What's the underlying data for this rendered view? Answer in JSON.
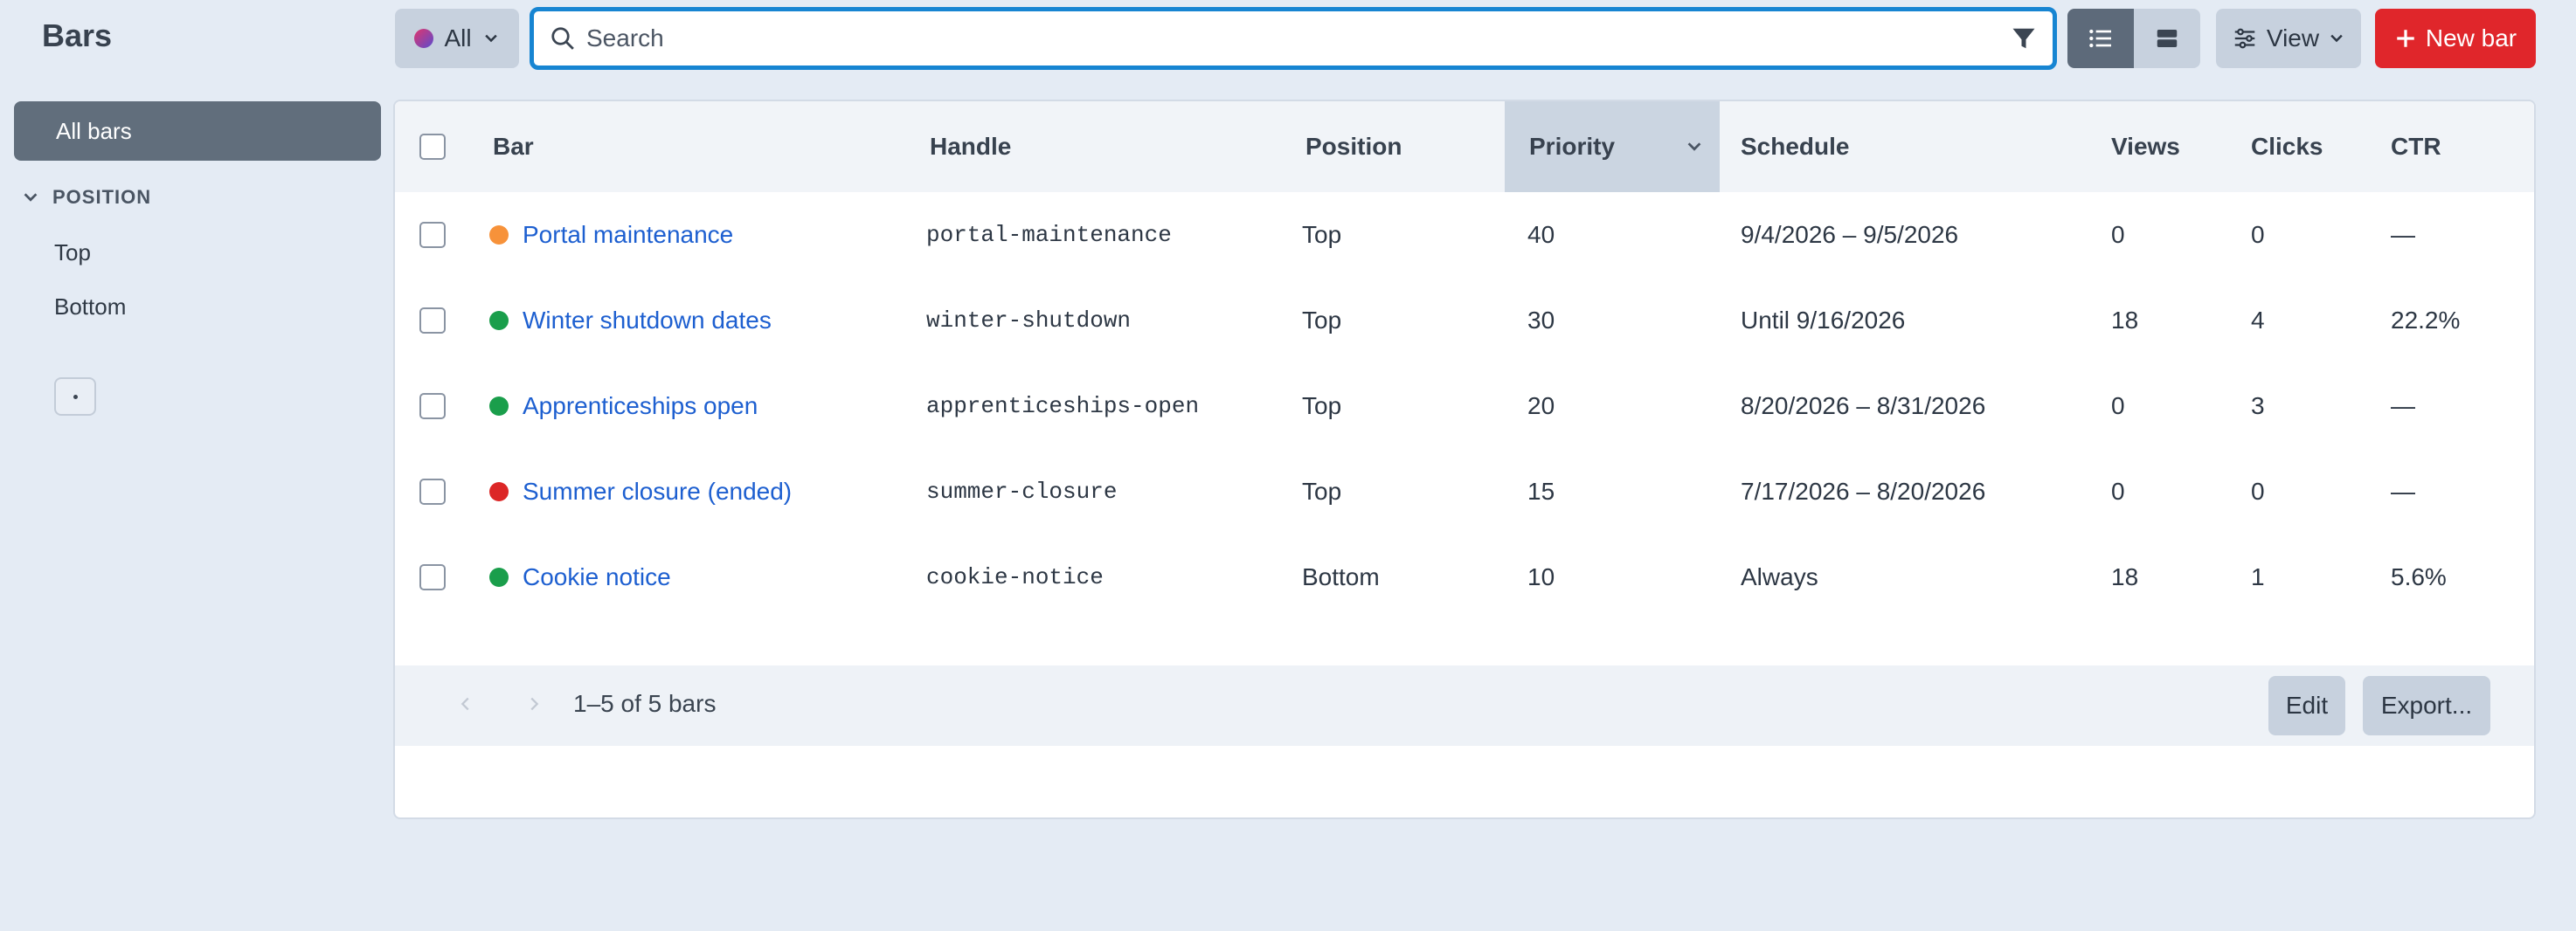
{
  "page": {
    "title": "Bars"
  },
  "sidebar": {
    "all_label": "All bars",
    "position_header": "POSITION",
    "items": [
      {
        "label": "Top"
      },
      {
        "label": "Bottom"
      }
    ]
  },
  "toolbar": {
    "filter_label": "All",
    "search_placeholder": "Search",
    "view_label": "View",
    "new_label": "New bar"
  },
  "table": {
    "columns": [
      "Bar",
      "Handle",
      "Position",
      "Priority",
      "Schedule",
      "Views",
      "Clicks",
      "CTR"
    ],
    "sorted_column": "Priority",
    "rows": [
      {
        "status": "scheduled",
        "status_color": "#f7923a",
        "bar": "Portal maintenance",
        "handle": "portal-maintenance",
        "position": "Top",
        "priority": "40",
        "schedule": "9/4/2026 – 9/5/2026",
        "views": "0",
        "clicks": "0",
        "ctr": "—"
      },
      {
        "status": "active",
        "status_color": "#1a9e4b",
        "bar": "Winter shutdown dates",
        "handle": "winter-shutdown",
        "position": "Top",
        "priority": "30",
        "schedule": "Until 9/16/2026",
        "views": "18",
        "clicks": "4",
        "ctr": "22.2%"
      },
      {
        "status": "active",
        "status_color": "#1a9e4b",
        "bar": "Apprenticeships open",
        "handle": "apprenticeships-open",
        "position": "Top",
        "priority": "20",
        "schedule": "8/20/2026 – 8/31/2026",
        "views": "0",
        "clicks": "3",
        "ctr": "—"
      },
      {
        "status": "ended",
        "status_color": "#dc2626",
        "bar": "Summer closure (ended)",
        "handle": "summer-closure",
        "position": "Top",
        "priority": "15",
        "schedule": "7/17/2026 – 8/20/2026",
        "views": "0",
        "clicks": "0",
        "ctr": "—"
      },
      {
        "status": "active",
        "status_color": "#1a9e4b",
        "bar": "Cookie notice",
        "handle": "cookie-notice",
        "position": "Bottom",
        "priority": "10",
        "schedule": "Always",
        "views": "18",
        "clicks": "1",
        "ctr": "5.6%"
      }
    ]
  },
  "footer": {
    "range_text": "1–5 of 5 bars",
    "edit_label": "Edit",
    "export_label": "Export..."
  },
  "colors": {
    "accent": "#1785d2",
    "primary_button": "#e0262b",
    "link": "#1d5fd0"
  }
}
